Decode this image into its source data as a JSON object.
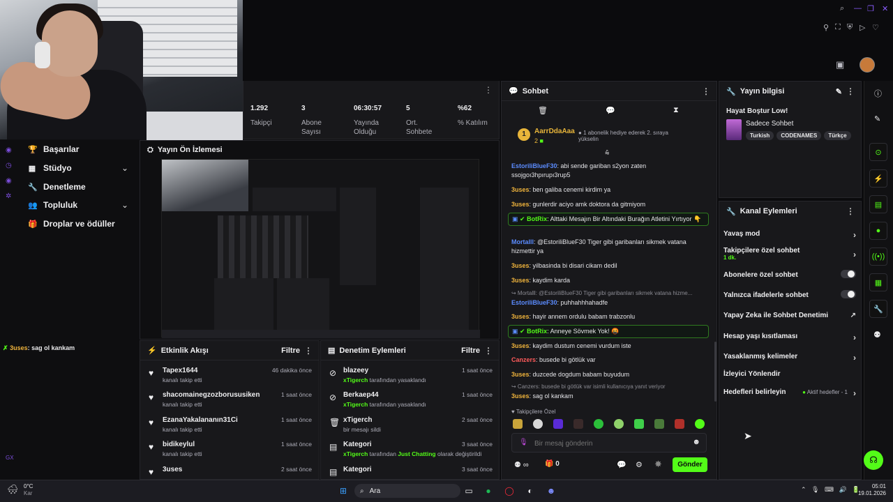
{
  "stats": [
    {
      "value": "1.292",
      "label": "Takipçi"
    },
    {
      "value": "3",
      "label": "Abone Sayısı"
    },
    {
      "value": "06:30:57",
      "label": "Yayında Olduğu"
    },
    {
      "value": "5",
      "label": "Ort. Sohbete"
    },
    {
      "value": "%62",
      "label": "% Katılım"
    }
  ],
  "sidebar": {
    "items": [
      {
        "label": "Başarılar",
        "icon": "trophy-icon"
      },
      {
        "label": "Stüdyo",
        "icon": "studio-icon"
      },
      {
        "label": "Denetleme",
        "icon": "wrench-icon"
      },
      {
        "label": "Topluluk",
        "icon": "people-icon"
      },
      {
        "label": "Droplar ve ödüller",
        "icon": "gift-icon"
      }
    ],
    "overlay_chat": {
      "user": "3uses",
      "text": ": sag ol kankam"
    }
  },
  "preview": {
    "title": "Yayın Ön İzlemesi"
  },
  "activity": {
    "title": "Etkinlik Akışı",
    "filter": "Filtre",
    "items": [
      {
        "name": "Tapex1644",
        "sub": "kanalı takip etti",
        "time": "46 dakika önce"
      },
      {
        "name": "shacomainegzozborususiken",
        "sub": "kanalı takip etti",
        "time": "1 saat önce"
      },
      {
        "name": "EzanaYakalananın31Ci",
        "sub": "kanalı takip etti",
        "time": "1 saat önce"
      },
      {
        "name": "bidikeylul",
        "sub": "kanalı takip etti",
        "time": "1 saat önce"
      },
      {
        "name": "3uses",
        "sub": "",
        "time": "2 saat önce"
      }
    ]
  },
  "moderation": {
    "title": "Denetim Eylemleri",
    "filter": "Filtre",
    "items": [
      {
        "name": "blazeey",
        "actor": "xTigerch",
        "sub": " tarafından yasaklandı",
        "extra": "",
        "extra2": "",
        "time": "1 saat önce"
      },
      {
        "name": "Berkaep44",
        "actor": "xTigerch",
        "sub": " tarafından yasaklandı",
        "extra": "",
        "extra2": "",
        "time": "1 saat önce"
      },
      {
        "name": "xTigerch",
        "actor": "",
        "sub": "bir mesajı sildi",
        "extra": "",
        "extra2": "",
        "time": "2 saat önce"
      },
      {
        "name": "Kategori",
        "actor": "xTigerch",
        "sub": " tarafından ",
        "extra": "Just Chatting",
        "extra2": " olarak değiştirildi",
        "time": "3 saat önce"
      },
      {
        "name": "Kategori",
        "actor": "",
        "sub": "",
        "extra": "",
        "extra2": "",
        "time": "3 saat önce"
      }
    ]
  },
  "chat": {
    "title": "Sohbet",
    "top_user": {
      "name": "AarrDdaAaa",
      "count": "2",
      "rank": "1",
      "gift_text": "1 abonelik hediye ederek 2. sıraya yükselin"
    },
    "messages": [
      {
        "user": "EstoriliBlueF30",
        "color": "#5b8cff",
        "text": ": abi sende gariban s2yon zaten ssojgoı3hpırupı3rup5"
      },
      {
        "user": "3uses",
        "color": "#f0b43c",
        "text": ": ben galiba cenemi kirdim ya"
      },
      {
        "user": "3uses",
        "color": "#f0b43c",
        "text": ": gunlerdir aciyo amk doktora da gitmiyom"
      },
      {
        "user": "BotRix",
        "color": "#53fc18",
        "text": ": Alttaki Mesajın Bir Altındaki Burağın Atletini Yırtıyor 👇"
      },
      {
        "user": "Mortalll",
        "color": "#5b8cff",
        "text": ": @EstoriliBlueF30 Tiger gibi garibanları sikmek vatana hizmettir ya"
      },
      {
        "user": "3uses",
        "color": "#f0b43c",
        "text": ": yilbasinda bi disari cikam dedil"
      },
      {
        "user": "3uses",
        "color": "#f0b43c",
        "text": ": kaydim karda"
      },
      {
        "reply": "↪ Mortalll: @EstoriliBlueF30 Tiger gibi garibanları sikmek vatana hizme..."
      },
      {
        "user": "EstoriliBlueF30",
        "color": "#5b8cff",
        "text": ": puhhahhhahadfe"
      },
      {
        "user": "3uses",
        "color": "#f0b43c",
        "text": ": hayir annem ordulu babam trabzonlu"
      },
      {
        "user": "BotRix",
        "color": "#53fc18",
        "text": ": Anneye Sövmek Yok! 🤬"
      },
      {
        "user": "3uses",
        "color": "#f0b43c",
        "text": ": kaydim dustum cenemi vurdum iste"
      },
      {
        "user": "Canzers",
        "color": "#ff5b5b",
        "text": ": busede bi götlük var"
      },
      {
        "user": "3uses",
        "color": "#f0b43c",
        "text": ": duzcede dogdum babam buyudum"
      },
      {
        "reply": "↪ Canzers: busede bi götlük var isimli kullanıcıya yanıt veriyor"
      },
      {
        "user": "3uses",
        "color": "#f0b43c",
        "text": ": sag ol kankam"
      }
    ],
    "emote_section": "Takipçilere Özel",
    "input_placeholder": "Bir mesaj gönderin",
    "send_label": "Gönder",
    "gift_count": "0"
  },
  "stream_info": {
    "title_header": "Yayın bilgisi",
    "stream_title": "Hayat Boştur Low!",
    "category": "Sadece Sohbet",
    "tags": [
      "Turkish",
      "CODENAMES",
      "Türkçe"
    ]
  },
  "channel_actions": {
    "title": "Kanal Eylemleri",
    "items": [
      {
        "label": "Yavaş mod",
        "type": "arrow"
      },
      {
        "label": "Takipçilere özel sohbet",
        "sub": "1 dk.",
        "type": "arrow"
      },
      {
        "label": "Abonelere özel sohbet",
        "type": "toggle"
      },
      {
        "label": "Yalnızca ifadelerle sohbet",
        "type": "toggle"
      },
      {
        "label": "Yapay Zeka ile Sohbet Denetimi",
        "type": "external"
      },
      {
        "label": "Hesap yaşı kısıtlaması",
        "type": "arrow"
      },
      {
        "label": "Yasaklanmış kelimeler",
        "type": "arrow"
      },
      {
        "label": "İzleyici Yönlendir",
        "type": "none"
      },
      {
        "label": "Hedefleri belirleyin",
        "badge": "Aktif hedefler - 1",
        "type": "arrow"
      }
    ]
  },
  "taskbar": {
    "weather_temp": "0°C",
    "weather_text": "Kar",
    "search_label": "Ara",
    "time": "05:01",
    "date": "19.01.2026"
  },
  "colors": {
    "accent": "#53fc18",
    "panel": "#18181b",
    "background": "#0b0b0d"
  }
}
